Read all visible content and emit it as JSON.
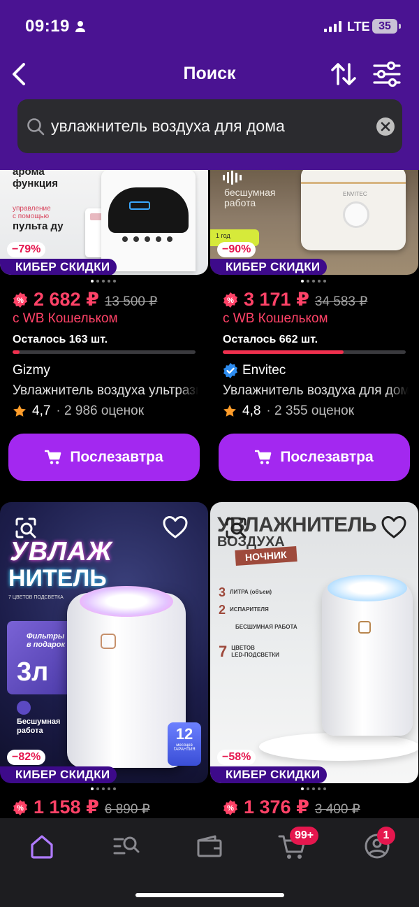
{
  "status": {
    "time": "09:19",
    "network": "LTE",
    "battery": "35"
  },
  "nav": {
    "title": "Поиск"
  },
  "search": {
    "query": "увлажнитель воздуха для дома"
  },
  "products": [
    {
      "discount": "−79%",
      "promo": "КИБЕР СКИДКИ",
      "image_text": [
        "арома",
        "функция",
        "управление",
        "с помощью",
        "пульта ду"
      ],
      "price": "2 682 ₽",
      "old_price": "13 500 ₽",
      "wallet": "с WB Кошельком",
      "stock": "Осталось 163 шт.",
      "stock_level": 0.04,
      "brand": "Gizmy",
      "verified": false,
      "name": "Увлажнитель воздуха ультразвуковой",
      "rating": "4,7",
      "reviews": "· 2 986 оценок",
      "button": "Послезавтра"
    },
    {
      "discount": "−90%",
      "promo": "КИБЕР СКИДКИ",
      "image_text": [
        "бесшумная",
        "работа",
        "ENVITEC",
        "1 год"
      ],
      "price": "3 171 ₽",
      "old_price": "34 583 ₽",
      "wallet": "с WB Кошельком",
      "stock": "Осталось 662 шт.",
      "stock_level": 0.66,
      "brand": "Envitec",
      "verified": true,
      "name": "Увлажнитель воздуха для дома",
      "rating": "4,8",
      "reviews": "· 2 355 оценок",
      "button": "Послезавтра"
    },
    {
      "discount": "−82%",
      "promo": "КИБЕР СКИДКИ",
      "image_text": [
        "УВЛАЖ",
        "НИТЕЛЬ",
        "7 ЦВЕТОВ ПОДСВЕТКА",
        "Фильтры",
        "в подарок",
        "3л",
        "Бесшумная",
        "работа",
        "12",
        "месяцев",
        "ГАРАНТИЯ"
      ],
      "price": "1 158 ₽",
      "old_price": "6 890 ₽"
    },
    {
      "discount": "−58%",
      "promo": "КИБЕР СКИДКИ",
      "image_text": [
        "УВЛАЖНИТЕЛЬ",
        "ВОЗДУХА",
        "НОЧНИК",
        "3",
        "ЛИТРА (объем)",
        "2",
        "ИСПАРИТЕЛЯ",
        "БЕСШУМНАЯ РАБОТА",
        "7",
        "ЦВЕТОВ",
        "LED-ПОДСВЕТКИ"
      ],
      "price": "1 376 ₽",
      "old_price": "3 400 ₽"
    }
  ],
  "tabbar": {
    "tabs": [
      "home-icon",
      "catalog-search-icon",
      "wallet-icon",
      "cart-icon",
      "profile-icon"
    ],
    "cart_badge": "99+",
    "profile_badge": "1"
  },
  "colors": {
    "header": "#4a1392",
    "accent": "#a328f0",
    "price": "#ff4267",
    "promo": "#3d0a8a"
  }
}
